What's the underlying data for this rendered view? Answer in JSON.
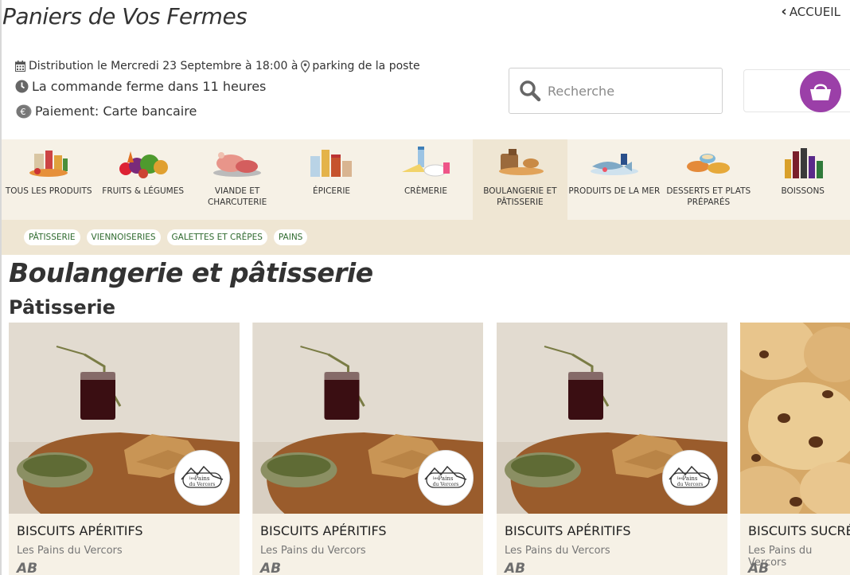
{
  "header": {
    "site_title": "Paniers de Vos Fermes",
    "home_label": "ACCUEIL"
  },
  "info": {
    "distribution_text": "Distribution le Mercredi 23 Septembre à 18:00 à",
    "location_text": "parking de la poste",
    "closing_text": "La commande ferme dans 11 heures",
    "payment_text": "Paiement: Carte bancaire"
  },
  "search": {
    "placeholder": "Recherche"
  },
  "categories": [
    {
      "label": "TOUS LES PRODUITS",
      "icon": "groceries-icon"
    },
    {
      "label": "FRUITS & LÉGUMES",
      "icon": "vegetables-icon"
    },
    {
      "label": "VIANDE ET CHARCUTERIE",
      "icon": "meat-icon"
    },
    {
      "label": "ÉPICERIE",
      "icon": "jars-icon"
    },
    {
      "label": "CRÈMERIE",
      "icon": "dairy-icon"
    },
    {
      "label": "BOULANGERIE ET PÂTISSERIE",
      "icon": "bread-icon",
      "active": true
    },
    {
      "label": "PRODUITS DE LA MER",
      "icon": "fish-icon"
    },
    {
      "label": "DESSERTS ET PLATS PRÉPARÉS",
      "icon": "dishes-icon"
    },
    {
      "label": "BOISSONS",
      "icon": "bottles-icon"
    }
  ],
  "subcategories": [
    "PÂTISSERIE",
    "VIENNOISERIES",
    "GALETTES ET CRÊPES",
    "PAINS"
  ],
  "section": {
    "title": "Boulangerie et pâtisserie",
    "subtitle": "Pâtisserie"
  },
  "products": [
    {
      "name": "BISCUITS APÉRITIFS",
      "producer": "Les Pains du Vercors",
      "label": "AB"
    },
    {
      "name": "BISCUITS APÉRITIFS",
      "producer": "Les Pains du Vercors",
      "label": "AB"
    },
    {
      "name": "BISCUITS APÉRITIFS",
      "producer": "Les Pains du Vercors",
      "label": "AB"
    },
    {
      "name": "BISCUITS SUCRÉ",
      "producer": "Les Pains du Vercors",
      "label": "AB"
    }
  ],
  "badge": {
    "line1": "les",
    "line2": "Pains",
    "line3": "du Vercors"
  },
  "colors": {
    "cart": "#9b3fa8",
    "chip_text": "#2e6a2e",
    "bar_bg": "#f6f1e6",
    "bar_active": "#efe6d3"
  }
}
